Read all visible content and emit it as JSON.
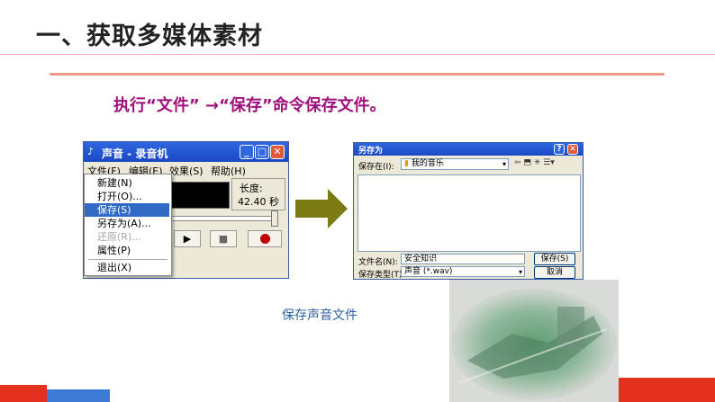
{
  "slide": {
    "title": "一、获取多媒体素材",
    "instruction": "执行“文件” →“保存”命令保存文件。",
    "caption": "保存声音文件"
  },
  "recorder": {
    "title": "声音 - 录音机",
    "menu": [
      "文件(F)",
      "编辑(E)",
      "效果(S)",
      "帮助(H)"
    ],
    "file_menu_items": [
      "新建(N)",
      "打开(O)...",
      "保存(S)",
      "另存为(A)...",
      "还原(R)...",
      "属性(P)",
      "退出(X)"
    ],
    "highlighted_item": "保存(S)",
    "disabled_item": "还原(R)...",
    "length_label": "长度:",
    "length_value": "42.40 秒",
    "play_symbol": "▶",
    "stop_symbol": "■"
  },
  "save_dialog": {
    "title": "另存为",
    "save_in_label": "保存在(I):",
    "save_in_value": "我的音乐",
    "help_symbol": "?",
    "close_symbol": "✕",
    "filename_label": "文件名(N):",
    "filename_value": "安全知识",
    "filetype_label": "保存类型(T):",
    "filetype_value": "声音 (*.wav)",
    "save_button": "保存(S)",
    "cancel_button": "取消"
  },
  "colors": {
    "title_text": "#222222",
    "instruction_text": "#a0107c",
    "caption_text": "#2c5f9e",
    "accent_rule": "#ec9a88",
    "arrow": "#7c7a12",
    "footer_red": "#e4301e",
    "footer_blue": "#3d7bd6",
    "xp_titlebar": "#1a48c4"
  }
}
